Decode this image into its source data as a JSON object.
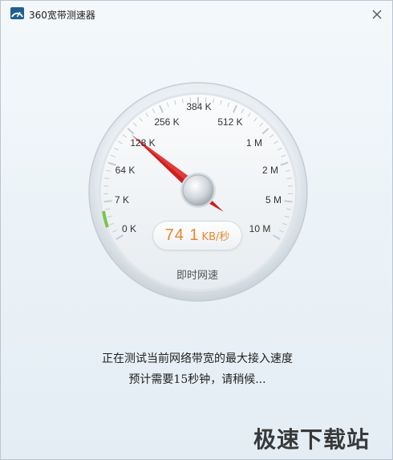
{
  "window": {
    "title": "360宽带测速器"
  },
  "gauge": {
    "ticks": [
      "0 K",
      "7 K",
      "64 K",
      "128 K",
      "256 K",
      "384 K",
      "512 K",
      "1 M",
      "2 M",
      "5 M",
      "10 M"
    ],
    "speed_value": "74 1",
    "speed_unit": "KB/秒",
    "caption": "即时网速",
    "accent_color": "#e8862a",
    "needle_color": "#cc1f1f"
  },
  "status": {
    "line1": "正在测试当前网络带宽的最大接入速度",
    "line2": "预计需要15秒钟，请稍候..."
  },
  "watermark": "极速下载站"
}
